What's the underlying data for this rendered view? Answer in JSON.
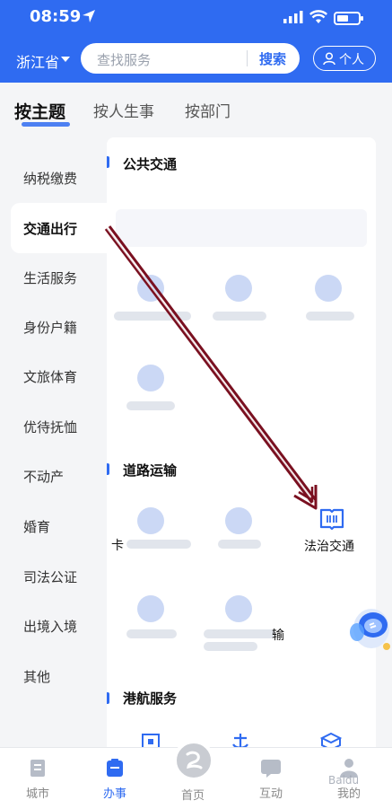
{
  "status": {
    "time": "08:59"
  },
  "header": {
    "province": "浙江省",
    "search_placeholder": "查找服务",
    "search_button": "搜索",
    "personal_button": "个人"
  },
  "tabs": [
    {
      "label": "按主题",
      "active": true
    },
    {
      "label": "按人生事",
      "active": false
    },
    {
      "label": "按部门",
      "active": false
    }
  ],
  "sidebar": {
    "items": [
      {
        "label": "纳税缴费"
      },
      {
        "label": "交通出行",
        "active": true
      },
      {
        "label": "生活服务"
      },
      {
        "label": "身份户籍"
      },
      {
        "label": "文旅体育"
      },
      {
        "label": "优待抚恤"
      },
      {
        "label": "不动产"
      },
      {
        "label": "婚育"
      },
      {
        "label": "司法公证"
      },
      {
        "label": "出境入境"
      },
      {
        "label": "其他"
      }
    ]
  },
  "content": {
    "sections": [
      {
        "title": "公共交通"
      },
      {
        "title": "道路运输"
      },
      {
        "title": "港航服务"
      }
    ],
    "visible_service": {
      "label": "法治交通",
      "icon": "law-book-icon"
    },
    "stray_chars": [
      "卡",
      "输"
    ]
  },
  "bottom_nav": [
    {
      "label": "城市",
      "icon": "city-icon"
    },
    {
      "label": "办事",
      "icon": "service-icon",
      "active": true
    },
    {
      "label": "首页",
      "icon": "home-icon"
    },
    {
      "label": "互动",
      "icon": "chat-icon"
    },
    {
      "label": "我的",
      "icon": "user-icon"
    }
  ],
  "colors": {
    "brand": "#2f6bf1",
    "arrow": "#7a1020"
  }
}
